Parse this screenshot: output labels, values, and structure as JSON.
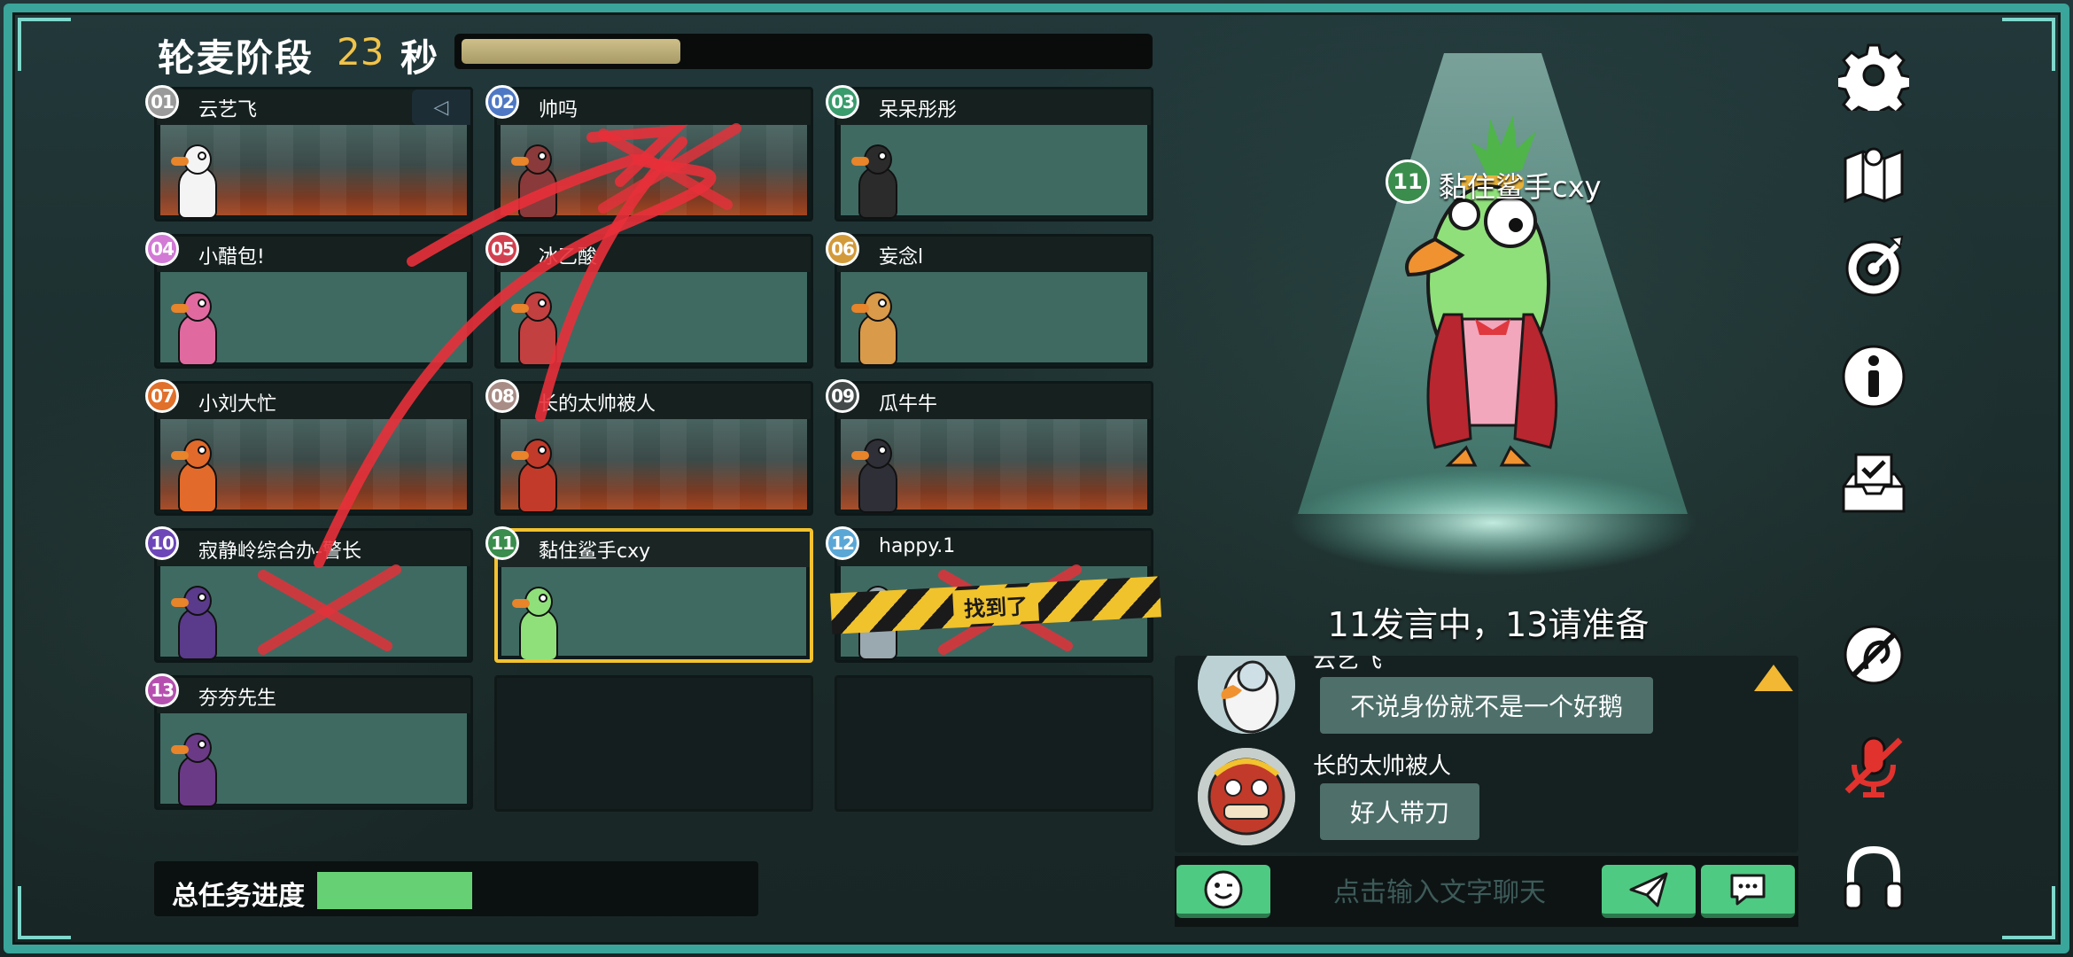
{
  "header": {
    "phase_title": "轮麦阶段",
    "seconds": "23",
    "seconds_unit": "秒",
    "timer_progress": 0.32
  },
  "players": [
    {
      "num": "01",
      "name": "云艺飞",
      "color": "#9a9a9a",
      "scene": true,
      "muted": true,
      "crossed": false
    },
    {
      "num": "02",
      "name": "帅吗",
      "color": "#4f78c4",
      "scene": true,
      "muted": false,
      "crossed": true
    },
    {
      "num": "03",
      "name": "呆呆彤彤",
      "color": "#3a9b6d",
      "scene": false,
      "muted": false,
      "crossed": false
    },
    {
      "num": "04",
      "name": "小醋包!",
      "color": "#d27ad6",
      "scene": false,
      "muted": false,
      "crossed": false
    },
    {
      "num": "05",
      "name": "冰乙酸",
      "color": "#d2404f",
      "scene": false,
      "muted": false,
      "crossed": false
    },
    {
      "num": "06",
      "name": "妄念l",
      "color": "#d39a3a",
      "scene": false,
      "muted": false,
      "crossed": false
    },
    {
      "num": "07",
      "name": "小刘大忙",
      "color": "#e0702a",
      "scene": true,
      "muted": false,
      "crossed": false
    },
    {
      "num": "08",
      "name": "长的太帅被人",
      "color": "#a88c86",
      "scene": true,
      "muted": false,
      "crossed": false
    },
    {
      "num": "09",
      "name": "瓜牛牛",
      "color": "#444a4a",
      "scene": true,
      "muted": false,
      "crossed": false
    },
    {
      "num": "10",
      "name": "寂静岭综合办-警长",
      "color": "#6d47b8",
      "scene": false,
      "muted": false,
      "crossed": true
    },
    {
      "num": "11",
      "name": "黏住鲨手cxy",
      "color": "#3a8d4d",
      "scene": false,
      "muted": false,
      "crossed": false
    },
    {
      "num": "12",
      "name": "happy.1",
      "color": "#5aa7d6",
      "scene": false,
      "muted": false,
      "crossed": true
    },
    {
      "num": "13",
      "name": "夯夯先生",
      "color": "#b650b0",
      "scene": false,
      "muted": false,
      "crossed": false
    }
  ],
  "found_label": "找到了",
  "task": {
    "label": "总任务进度",
    "progress": 0.25
  },
  "speaker": {
    "num": "11",
    "name": "黏住鲨手cxy"
  },
  "speak_status": "11发言中，13请准备",
  "chat": {
    "messages": [
      {
        "name": "云艺飞",
        "text": "不说身份就不是一个好鹅"
      },
      {
        "name": "长的太帅被人",
        "text": "好人带刀"
      }
    ],
    "placeholder": "点击输入文字聊天"
  },
  "toolbar": [
    "gear-icon",
    "map-icon",
    "target-icon",
    "info-icon",
    "task-check-icon",
    "ear-off-icon",
    "mic-off-icon",
    "headphones-icon"
  ],
  "colors": {
    "frame": "#3aa59a",
    "accent_gold": "#f0c34a",
    "active_border": "#f2c22f",
    "button_green": "#4fca83",
    "task_fill": "#66d174",
    "mic_off": "#e2322e"
  }
}
